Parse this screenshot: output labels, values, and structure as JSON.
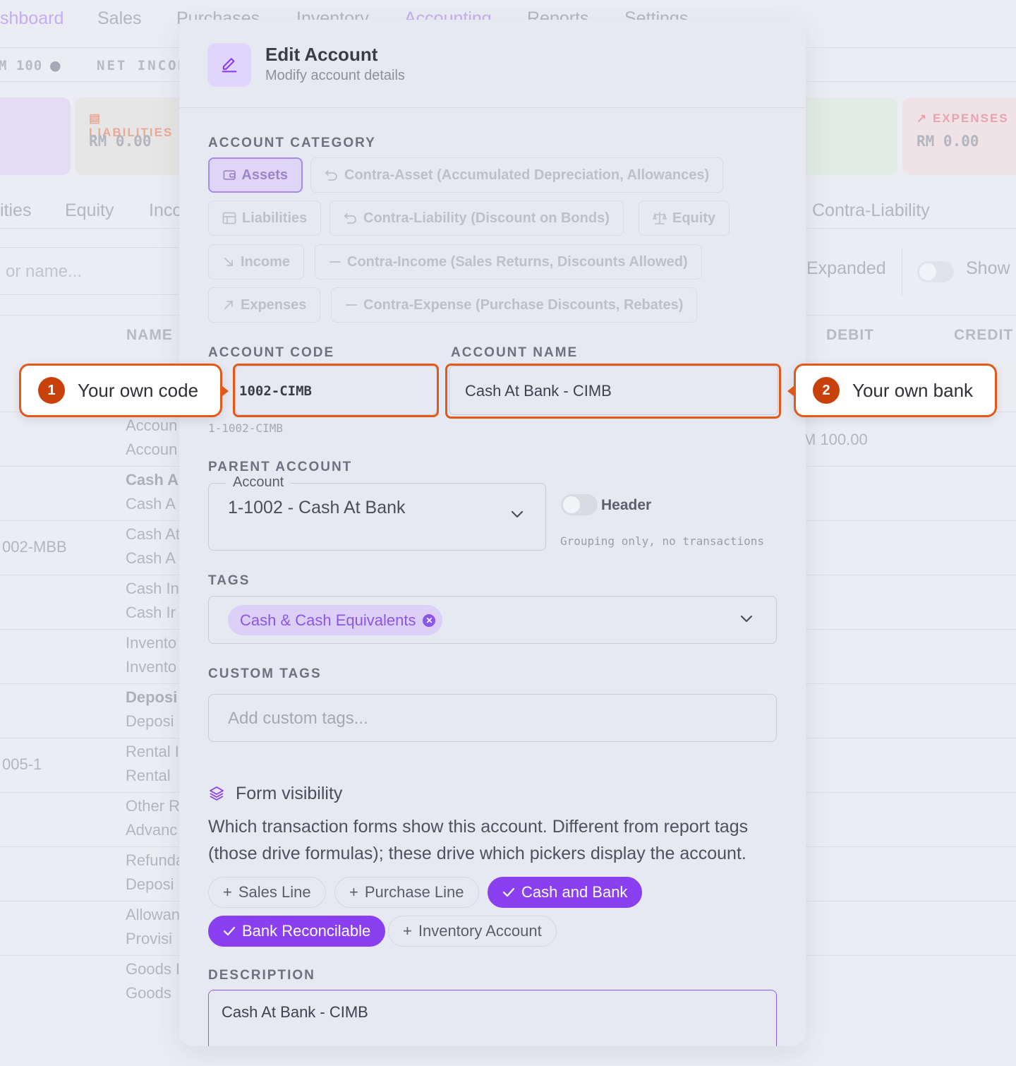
{
  "background": {
    "nav": [
      "shboard",
      "Sales",
      "Purchases",
      "Inventory",
      "Accounting",
      "Reports",
      "Settings"
    ],
    "stats": {
      "left": "M 100",
      "net_income": "NET INCOM"
    },
    "cards": {
      "liabilities_label": "LIABILITIES",
      "liabilities_value": "RM 0.00",
      "expenses_label": "EXPENSES",
      "expenses_value": "RM 0.00"
    },
    "tabs": [
      "ities",
      "Equity",
      "Inco",
      "Contra-Liability"
    ],
    "search_placeholder": "or name...",
    "toolbar": {
      "expanded": "Expanded",
      "show": "Show"
    },
    "table_headers": {
      "name": "NAME",
      "debit": "DEBIT",
      "credit": "CREDIT"
    },
    "rows": [
      {
        "code": "",
        "l1": "Accoun",
        "l2": "Accoun",
        "amount": "M 100.00",
        "bold": false
      },
      {
        "code": "",
        "l1": "Cash A",
        "l2": "Cash A",
        "amount": "",
        "bold": true
      },
      {
        "code": "002-MBB",
        "l1": "Cash At",
        "l2": "Cash A",
        "amount": "",
        "bold": false
      },
      {
        "code": "",
        "l1": "Cash In",
        "l2": "Cash Ir",
        "amount": "",
        "bold": false
      },
      {
        "code": "",
        "l1": "Invento",
        "l2": "Invento",
        "amount": "",
        "bold": false
      },
      {
        "code": "",
        "l1": "Deposi",
        "l2": "Deposi",
        "amount": "",
        "bold": true
      },
      {
        "code": "005-1",
        "l1": "Rental I",
        "l2": "Rental",
        "amount": "",
        "bold": false
      },
      {
        "code": "",
        "l1": "Other R",
        "l2": "Advanc",
        "amount": "",
        "bold": false
      },
      {
        "code": "",
        "l1": "Refunda",
        "l2": "Deposi",
        "amount": "",
        "bold": false
      },
      {
        "code": "",
        "l1": "Allowan",
        "l2": "Provisi",
        "amount": "",
        "bold": false
      },
      {
        "code": "",
        "l1": "Goods I",
        "l2": "Goods",
        "amount": "",
        "bold": false
      }
    ]
  },
  "modal": {
    "title": "Edit Account",
    "subtitle": "Modify account details",
    "account_category_label": "ACCOUNT CATEGORY",
    "categories": [
      {
        "label": "Assets",
        "icon": "wallet-icon",
        "selected": true
      },
      {
        "label": "Contra-Asset (Accumulated Depreciation, Allowances)",
        "icon": "undo-icon",
        "selected": false
      },
      {
        "label": "Liabilities",
        "icon": "ledger-icon",
        "selected": false
      },
      {
        "label": "Contra-Liability (Discount on Bonds)",
        "icon": "undo-icon",
        "selected": false
      },
      {
        "label": "Equity",
        "icon": "scale-icon",
        "selected": false
      },
      {
        "label": "Income",
        "icon": "arrow-down-right-icon",
        "selected": false
      },
      {
        "label": "Contra-Income (Sales Returns, Discounts Allowed)",
        "icon": "minus-icon",
        "selected": false
      },
      {
        "label": "Expenses",
        "icon": "arrow-up-right-icon",
        "selected": false
      },
      {
        "label": "Contra-Expense (Purchase Discounts, Rebates)",
        "icon": "minus-icon",
        "selected": false
      }
    ],
    "account_code_label": "ACCOUNT CODE",
    "account_code": "1002-CIMB",
    "account_code_hint": "1-1002-CIMB",
    "account_name_label": "ACCOUNT NAME",
    "account_name": "Cash At Bank - CIMB",
    "parent_account_label": "PARENT ACCOUNT",
    "parent_legend": "Account",
    "parent_value": "1-1002 - Cash At Bank",
    "header_toggle_label": "Header",
    "header_toggle_on": false,
    "header_help": "Grouping only, no transactions",
    "tags_label": "TAGS",
    "tags": [
      "Cash & Cash Equivalents"
    ],
    "custom_tags_label": "CUSTOM TAGS",
    "custom_tags_placeholder": "Add custom tags...",
    "form_visibility_title": "Form visibility",
    "form_visibility_desc": "Which transaction forms show this account. Different from report tags (those drive formulas); these drive which pickers display the account.",
    "visibility": [
      {
        "label": "Sales Line",
        "on": false
      },
      {
        "label": "Purchase Line",
        "on": false
      },
      {
        "label": "Cash and Bank",
        "on": true
      },
      {
        "label": "Bank Reconcilable",
        "on": true
      },
      {
        "label": "Inventory Account",
        "on": false
      }
    ],
    "description_label": "DESCRIPTION",
    "description": "Cash At Bank - CIMB"
  },
  "callouts": [
    {
      "number": "1",
      "text": "Your own code"
    },
    {
      "number": "2",
      "text": "Your own bank"
    }
  ],
  "colors": {
    "accent": "#8a3ff0",
    "callout": "#e2591a",
    "callout_badge": "#c8410b"
  }
}
